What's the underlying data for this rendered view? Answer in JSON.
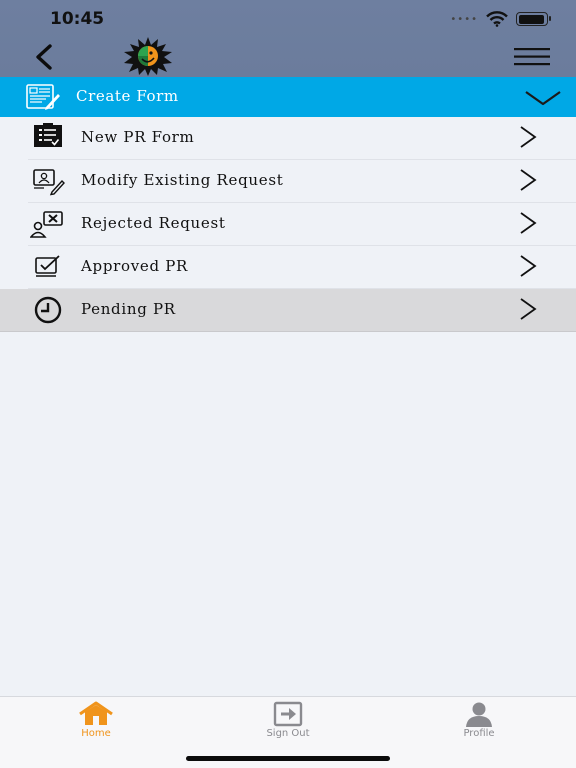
{
  "status_bar": {
    "time": "10:45",
    "signal": "••••",
    "battery_level": 0.95
  },
  "header": {
    "back_icon": "chevron-left-icon",
    "logo_icon": "sun-logo-icon",
    "menu_icon": "hamburger-menu-icon"
  },
  "section": {
    "title": "Create Form",
    "icon": "form-document-icon",
    "expanded_icon": "chevron-down-icon"
  },
  "menu_items": [
    {
      "label": "New PR Form",
      "icon": "clipboard-list-icon",
      "active": false
    },
    {
      "label": "Modify Existing Request",
      "icon": "edit-request-icon",
      "active": false
    },
    {
      "label": "Rejected Request",
      "icon": "rejected-user-icon",
      "active": false
    },
    {
      "label": "Approved PR",
      "icon": "approved-check-icon",
      "active": false
    },
    {
      "label": "Pending PR",
      "icon": "clock-icon",
      "active": true
    }
  ],
  "tabs": [
    {
      "label": "Home",
      "icon": "home-icon",
      "selected": true
    },
    {
      "label": "Sign Out",
      "icon": "sign-out-icon",
      "selected": false
    },
    {
      "label": "Profile",
      "icon": "profile-icon",
      "selected": false
    }
  ],
  "colors": {
    "header_bg": "#6b7c9c",
    "section_bg": "#00a8e6",
    "active_row_bg": "#d9d9db",
    "tab_selected": "#f0941c",
    "tab_unselected": "#8a8a8f"
  }
}
